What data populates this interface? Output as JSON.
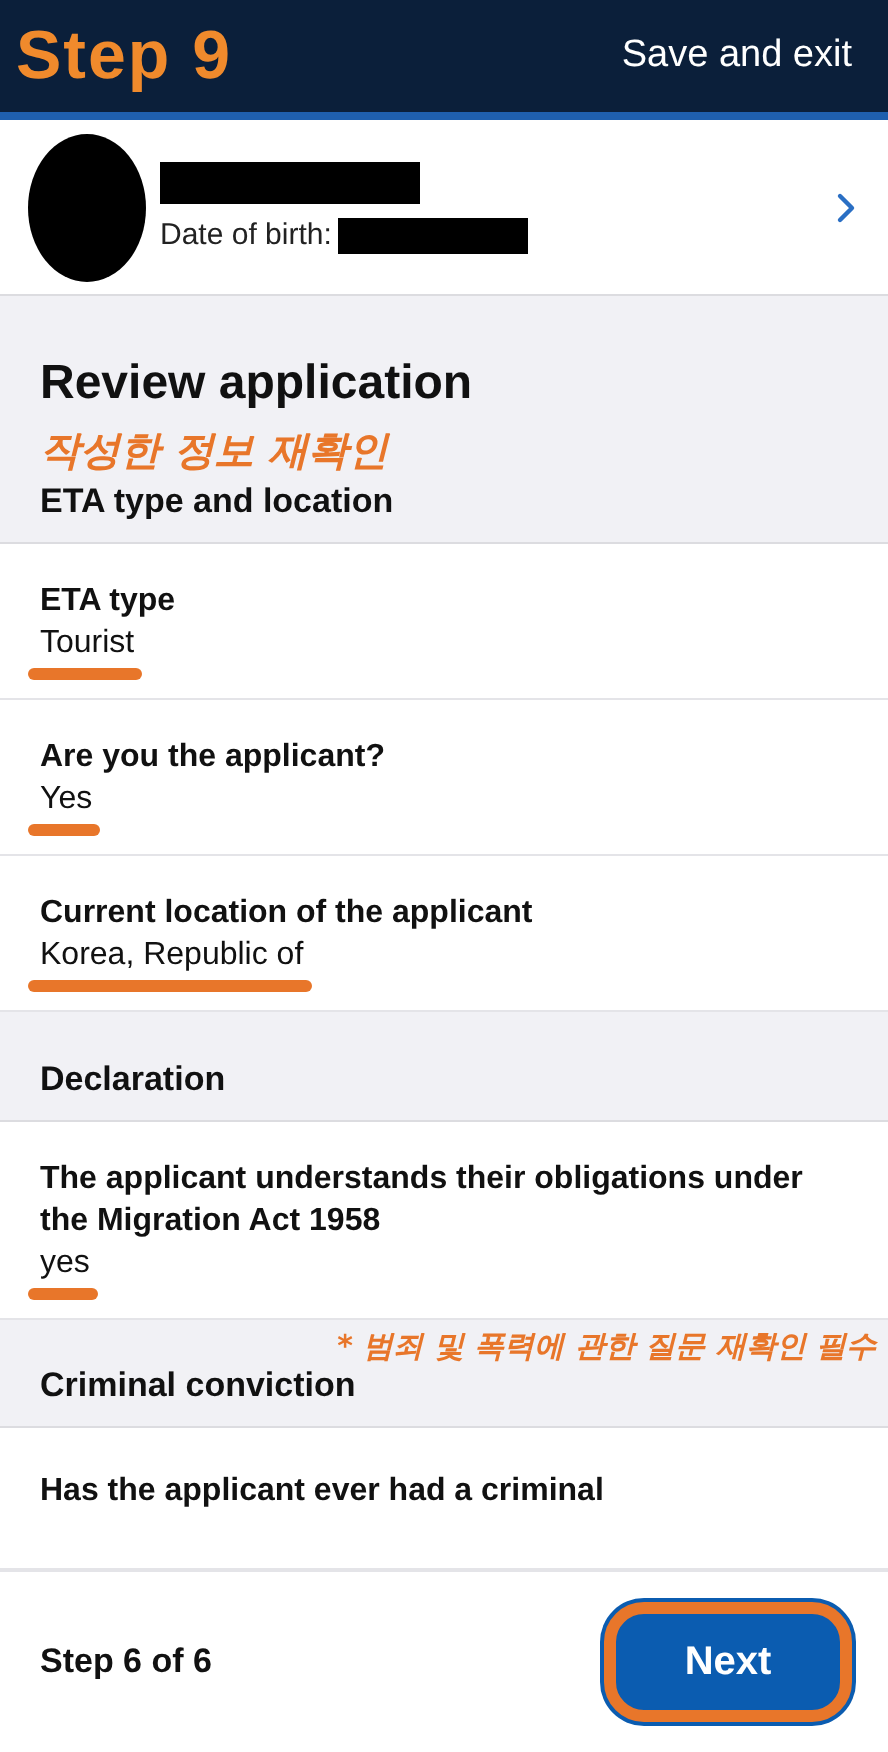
{
  "header": {
    "step_label": "Step 9",
    "action": "Save and exit"
  },
  "profile": {
    "dob_label": "Date of birth:"
  },
  "title": "Review application",
  "title_note": "작성한 정보 재확인",
  "sections": [
    {
      "heading": "ETA type and location",
      "rows": [
        {
          "label": "ETA type",
          "value": "Tourist",
          "underlined": true
        },
        {
          "label": "Are you the applicant?",
          "value": "Yes",
          "underlined": true
        },
        {
          "label": "Current location of the applicant",
          "value": "Korea, Republic of",
          "underlined": true
        }
      ]
    },
    {
      "heading": "Declaration",
      "rows": [
        {
          "label": "The applicant understands their obligations under the Migration Act 1958",
          "value": "yes",
          "underlined": true
        }
      ]
    },
    {
      "note": "* 범죄 및 폭력에 관한 질문 재확인 필수",
      "heading": "Criminal conviction",
      "rows": [
        {
          "label": "Has the applicant ever had a criminal"
        }
      ]
    }
  ],
  "footer": {
    "step": "Step 6 of 6",
    "button": {
      "label": "Next",
      "highlighted": true
    }
  }
}
